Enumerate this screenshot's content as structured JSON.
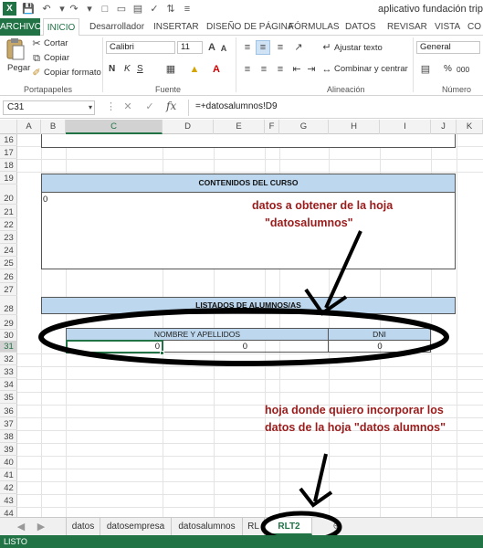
{
  "window": {
    "title": "aplicativo fundación tripartita"
  },
  "ribbon_tabs": [
    "ARCHIVO",
    "INICIO",
    "Desarrollador",
    "INSERTAR",
    "DISEÑO DE PÁGINA",
    "FÓRMULAS",
    "DATOS",
    "REVISAR",
    "VISTA",
    "CO"
  ],
  "ribbon": {
    "paste_label": "Pegar",
    "cut_label": "Cortar",
    "copy_label": "Copiar",
    "format_painter_label": "Copiar formato",
    "clipboard_group": "Portapapeles",
    "font_name": "Calibri",
    "font_size": "11",
    "bold": "N",
    "italic": "K",
    "underline": "S",
    "font_group": "Fuente",
    "wrap_text": "Ajustar texto",
    "merge_center": "Combinar y centrar",
    "alignment_group": "Alineación",
    "number_format": "General",
    "percent": "%",
    "thousands": "000",
    "number_group": "Número"
  },
  "formula_bar": {
    "cell_ref": "C31",
    "fx": "fx",
    "formula": "=+datosalumnos!D9"
  },
  "columns": [
    "A",
    "B",
    "C",
    "D",
    "E",
    "F",
    "G",
    "H",
    "I",
    "J",
    "K"
  ],
  "rows": [
    "16",
    "17",
    "18",
    "19",
    "20",
    "21",
    "22",
    "23",
    "24",
    "25",
    "26",
    "27",
    "28",
    "29",
    "30",
    "31",
    "32",
    "33",
    "34",
    "35",
    "36",
    "37",
    "38",
    "39",
    "40",
    "41",
    "42",
    "43",
    "44",
    "45"
  ],
  "sheet": {
    "contenidos_header": "CONTENIDOS DEL CURSO",
    "contenidos_value": "0",
    "listados_header": "LISTADOS DE ALUMNOS/AS",
    "table_col1": "NOMBRE Y APELLIDOS",
    "table_col2": "DNI",
    "row31_c": "0",
    "row31_d": "0",
    "row31_h": "0"
  },
  "annotations": {
    "top_line1": "datos a obtener de la hoja",
    "top_line2": "\"datosalumnos\"",
    "bottom_line1": "hoja donde quiero incorporar los",
    "bottom_line2": "datos de la hoja \"datos alumnos\""
  },
  "sheet_tabs": [
    "datos",
    "datosempresa",
    "datosalumnos",
    "RL",
    "RLT2"
  ],
  "active_sheet": "RLT2",
  "status": "LISTO",
  "colors": {
    "excel_green": "#217346",
    "header_fill": "#bdd7ee",
    "annotation": "#9b1b1b"
  }
}
